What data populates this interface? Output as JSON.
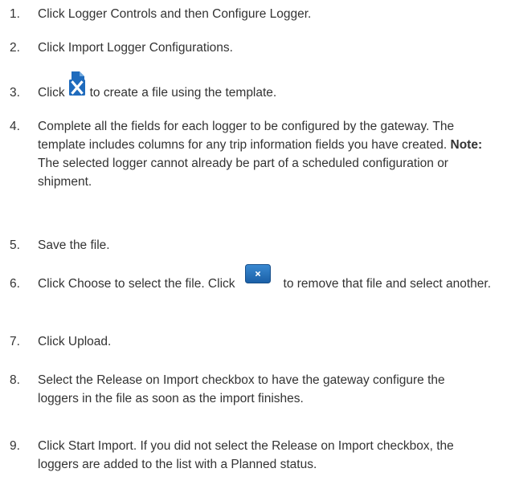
{
  "steps": [
    {
      "num": "1.",
      "text": "Click Logger Controls and then Configure Logger."
    },
    {
      "num": "2.",
      "text": "Click Import Logger Configurations."
    },
    {
      "num": "3.",
      "text_before": "Click",
      "text_after": "to create a file using the template.",
      "icon": "excel-template-icon"
    },
    {
      "num": "4.",
      "text": "Complete all the fields for each logger to be configured by the gateway. The template includes columns for any trip information fields you have created.",
      "note_label": "Note:",
      "note_text": "The selected logger cannot already be part of a scheduled configuration or shipment."
    },
    {
      "num": "5.",
      "text": "Save the file."
    },
    {
      "num": "6.",
      "text_before": "Click Choose to select the file. Click",
      "text_after": "to remove that file and select another.",
      "icon": "remove-file-icon"
    },
    {
      "num": "7.",
      "text": "Click Upload."
    },
    {
      "num": "8.",
      "text": "Select the Release on Import checkbox to have the gateway configure the loggers in the file as soon as the import finishes."
    },
    {
      "num": "9.",
      "text": "Click Start Import. If you did not select the Release on Import checkbox, the loggers are added to the list with a Planned status."
    }
  ],
  "colors": {
    "text": "#333333",
    "excel_blue": "#1f6bbd",
    "button_blue": "#1f6fb5"
  }
}
